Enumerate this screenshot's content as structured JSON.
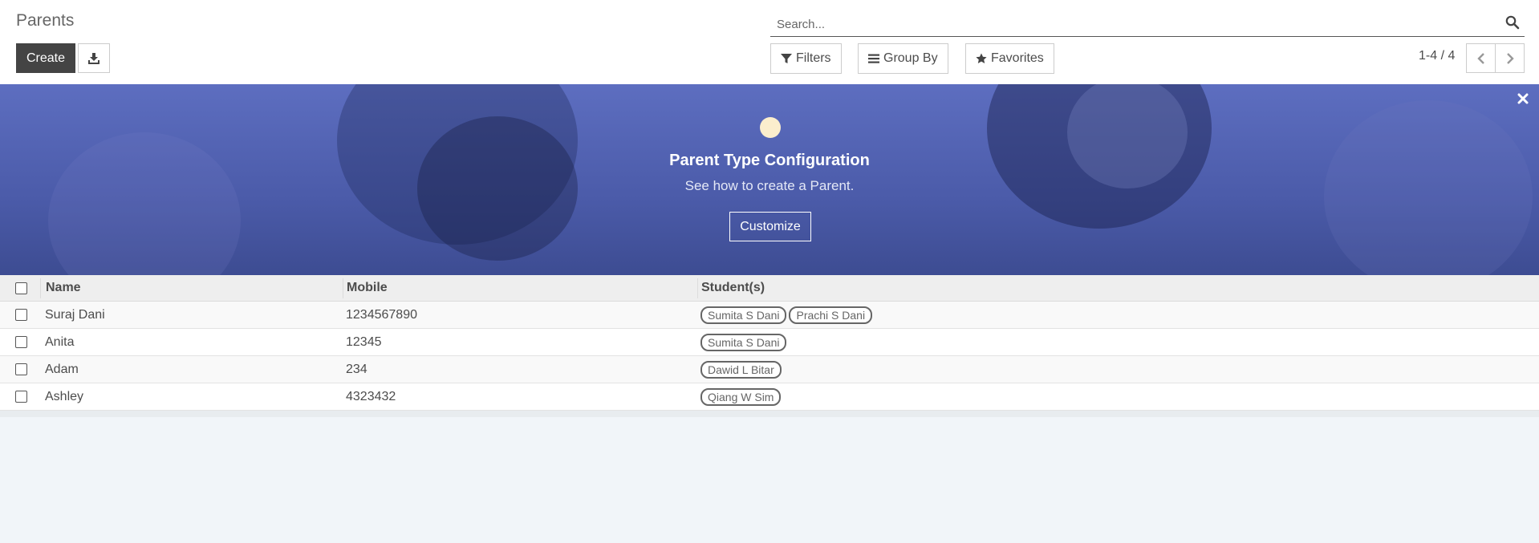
{
  "page": {
    "title": "Parents"
  },
  "toolbar": {
    "create_label": "Create",
    "export_icon": "download-icon"
  },
  "search": {
    "placeholder": "Search...",
    "icon": "search-icon"
  },
  "filters": {
    "filters_label": "Filters",
    "groupby_label": "Group By",
    "favorites_label": "Favorites"
  },
  "pager": {
    "value": "1-4 / 4"
  },
  "banner": {
    "title": "Parent Type Configuration",
    "subtitle": "See how to create a Parent.",
    "button_label": "Customize",
    "colors": {
      "bg": "#4b5ba9",
      "dot": "#fbeecd"
    }
  },
  "table": {
    "headers": {
      "name": "Name",
      "mobile": "Mobile",
      "students": "Student(s)"
    },
    "rows": [
      {
        "name": "Suraj Dani",
        "mobile": "1234567890",
        "students": [
          "Sumita S Dani",
          "Prachi S Dani"
        ]
      },
      {
        "name": "Anita",
        "mobile": "12345",
        "students": [
          "Sumita S Dani"
        ]
      },
      {
        "name": "Adam",
        "mobile": "234",
        "students": [
          "Dawid L Bitar"
        ]
      },
      {
        "name": "Ashley",
        "mobile": "4323432",
        "students": [
          "Qiang W Sim"
        ]
      }
    ]
  }
}
